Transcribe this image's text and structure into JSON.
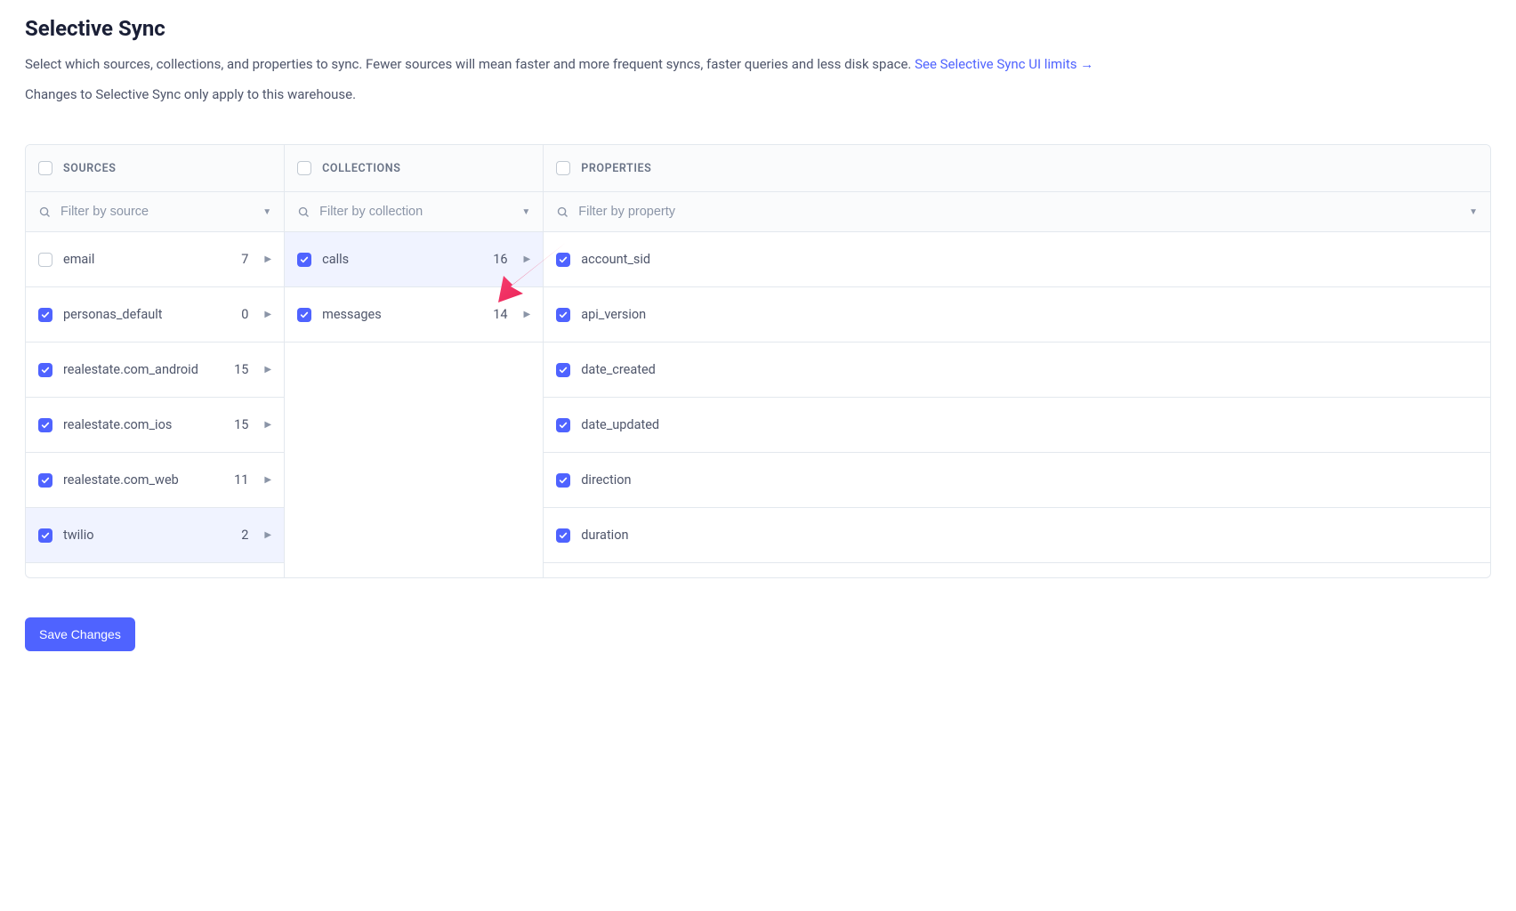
{
  "header": {
    "title": "Selective Sync",
    "desc_prefix": "Select which sources, collections, and properties to sync. Fewer sources will mean faster and more frequent syncs, faster queries and less disk space. ",
    "link_text": "See Selective Sync UI limits ",
    "desc_line2": "Changes to Selective Sync only apply to this warehouse."
  },
  "columns": {
    "sources": {
      "label": "SOURCES",
      "filter_placeholder": "Filter by source",
      "items": [
        {
          "name": "email",
          "count": "7",
          "checked": false,
          "selected": false
        },
        {
          "name": "personas_default",
          "count": "0",
          "checked": true,
          "selected": false
        },
        {
          "name": "realestate.com_android",
          "count": "15",
          "checked": true,
          "selected": false
        },
        {
          "name": "realestate.com_ios",
          "count": "15",
          "checked": true,
          "selected": false
        },
        {
          "name": "realestate.com_web",
          "count": "11",
          "checked": true,
          "selected": false
        },
        {
          "name": "twilio",
          "count": "2",
          "checked": true,
          "selected": true
        }
      ]
    },
    "collections": {
      "label": "COLLECTIONS",
      "filter_placeholder": "Filter by collection",
      "items": [
        {
          "name": "calls",
          "count": "16",
          "checked": true,
          "selected": true
        },
        {
          "name": "messages",
          "count": "14",
          "checked": true,
          "selected": false
        }
      ]
    },
    "properties": {
      "label": "PROPERTIES",
      "filter_placeholder": "Filter by property",
      "items": [
        {
          "name": "account_sid",
          "checked": true
        },
        {
          "name": "api_version",
          "checked": true
        },
        {
          "name": "date_created",
          "checked": true
        },
        {
          "name": "date_updated",
          "checked": true
        },
        {
          "name": "direction",
          "checked": true
        },
        {
          "name": "duration",
          "checked": true
        }
      ]
    }
  },
  "actions": {
    "save_label": "Save Changes"
  },
  "annotation": {
    "arrow_color": "#ed2f62"
  }
}
